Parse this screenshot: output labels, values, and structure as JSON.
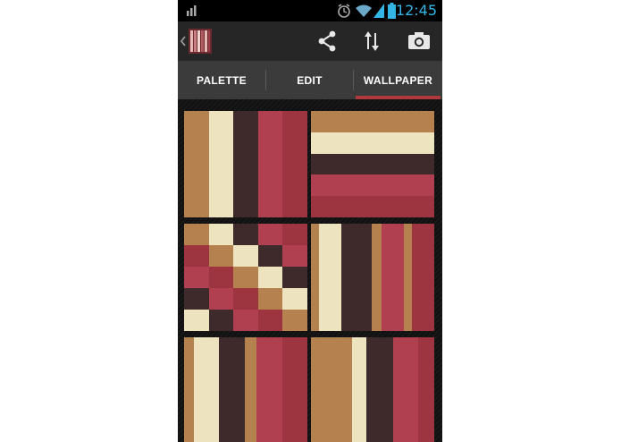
{
  "status_bar": {
    "time": "12:45",
    "icons": [
      "signal-bars-icon",
      "alarm-icon",
      "wifi-icon",
      "cell-signal-icon",
      "battery-icon"
    ]
  },
  "action_bar": {
    "up_icon": "chevron-left-icon",
    "app_icon": "palette-stripes-icon",
    "actions": [
      "share-icon",
      "sort-icon",
      "camera-icon"
    ]
  },
  "tabs": [
    {
      "label": "PALETTE",
      "selected": false
    },
    {
      "label": "EDIT",
      "selected": false
    },
    {
      "label": "WALLPAPER",
      "selected": true
    }
  ],
  "palette": {
    "tan": "#b5814f",
    "cream": "#ede3bf",
    "dark": "#3e2a2b",
    "red1": "#b0404f",
    "red2": "#9c3540",
    "accent": "#b0393d",
    "clock": "#33b5e5"
  },
  "wallpapers": [
    {
      "name": "vertical-stripes-wide",
      "type": "vertical",
      "stripes": [
        [
          "tan",
          1
        ],
        [
          "cream",
          1
        ],
        [
          "dark",
          1
        ],
        [
          "red1",
          1
        ],
        [
          "red2",
          1
        ]
      ]
    },
    {
      "name": "horizontal-stripes",
      "type": "horizontal",
      "stripes": [
        [
          "tan",
          1
        ],
        [
          "cream",
          1
        ],
        [
          "dark",
          1
        ],
        [
          "red1",
          1
        ],
        [
          "red2",
          1
        ]
      ]
    },
    {
      "name": "diagonal-checker",
      "type": "grid",
      "cols": 5,
      "cells": [
        "tan",
        "cream",
        "dark",
        "red1",
        "red2",
        "red2",
        "tan",
        "cream",
        "dark",
        "red1",
        "red1",
        "red2",
        "tan",
        "cream",
        "dark",
        "dark",
        "red1",
        "red2",
        "tan",
        "cream",
        "cream",
        "dark",
        "red1",
        "red2",
        "tan"
      ]
    },
    {
      "name": "vertical-stripes-mixed",
      "type": "vertical",
      "stripes": [
        [
          "tan",
          0.5
        ],
        [
          "cream",
          1.3
        ],
        [
          "dark",
          0.6
        ],
        [
          "dark",
          1.2
        ],
        [
          "tan",
          0.6
        ],
        [
          "red1",
          1.3
        ],
        [
          "tan",
          0.5
        ],
        [
          "red2",
          1.3
        ]
      ]
    },
    {
      "name": "vertical-stripes-thin",
      "type": "vertical",
      "stripes": [
        [
          "tan",
          0.5
        ],
        [
          "cream",
          1.3
        ],
        [
          "dark",
          1.3
        ],
        [
          "tan",
          0.6
        ],
        [
          "red1",
          1.3
        ],
        [
          "red2",
          1.3
        ]
      ]
    },
    {
      "name": "vertical-stripes-bold",
      "type": "vertical",
      "stripes": [
        [
          "tan",
          2
        ],
        [
          "cream",
          0.7
        ],
        [
          "dark",
          1.3
        ],
        [
          "red1",
          1.2
        ],
        [
          "red2",
          0.8
        ]
      ]
    }
  ]
}
